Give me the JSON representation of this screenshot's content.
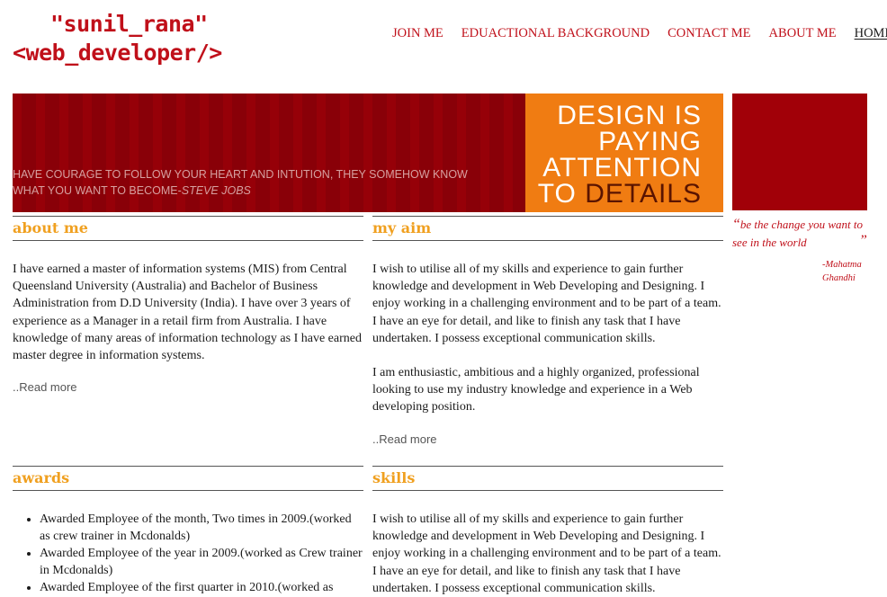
{
  "logo": {
    "line1": "\"sunil_rana\"",
    "line2": "<web_developer/>"
  },
  "nav": [
    {
      "label": "JOIN ME"
    },
    {
      "label": "EDUACTIONAL BACKGROUND"
    },
    {
      "label": "CONTACT ME"
    },
    {
      "label": "ABOUT ME"
    },
    {
      "label": "HOME",
      "active": true
    }
  ],
  "banner": {
    "quote": "HAVE COURAGE TO FOLLOW YOUR HEART AND INTUTION, THEY SOMEHOW KNOW WHAT YOU WANT TO BECOME-",
    "quote_author": "STEVE JOBS",
    "design_lines": [
      "DESIGN IS",
      "PAYING",
      "ATTENTION"
    ],
    "design_to": "TO",
    "design_details": "DETAILS"
  },
  "side_quote": {
    "open_mark": "“",
    "text": "be the change you want to see in the world",
    "close_mark": "”",
    "author_line1": "-Mahatma",
    "author_line2": "Ghandhi"
  },
  "about": {
    "title": "about me",
    "text": "I have earned a master of information systems (MIS) from Central Queensland University (Australia) and Bachelor of Business Administration from D.D University (India). I have over 3 years of experience as a Manager in a retail firm from Australia. I have knowledge of many areas of information technology as I have earned master degree in information systems.",
    "read_more": "..Read more"
  },
  "aim": {
    "title": "my aim",
    "text1": "I wish to utilise all of my skills and experience to gain further knowledge and development in Web Developing and Designing. I enjoy working in a challenging environment and to be part of a team. I have an eye for detail, and like to finish any task that I have undertaken. I possess exceptional communication skills.",
    "text2": "I am enthusiastic, ambitious and a highly organized, professional looking to use my industry knowledge and experience in a Web developing position.",
    "read_more": "..Read more"
  },
  "awards": {
    "title": "awards",
    "items": [
      "Awarded Employee of the month, Two times in 2009.(worked as crew trainer in Mcdonalds)",
      "Awarded Employee of the year in 2009.(worked as Crew trainer in Mcdonalds)",
      "Awarded Employee of the first quarter in 2010.(worked as"
    ]
  },
  "skills": {
    "title": "skills",
    "text": "I wish to utilise all of my skills and experience to gain further knowledge and development in Web Developing and Designing. I enjoy working in a challenging environment and to be part of a team. I have an eye for detail, and like to finish any task that I have undertaken. I possess exceptional communication skills."
  },
  "colors": {
    "brand_red": "#c0101a",
    "banner_red": "#8c0008",
    "orange": "#f07c12",
    "heading_orange": "#f0a020"
  }
}
